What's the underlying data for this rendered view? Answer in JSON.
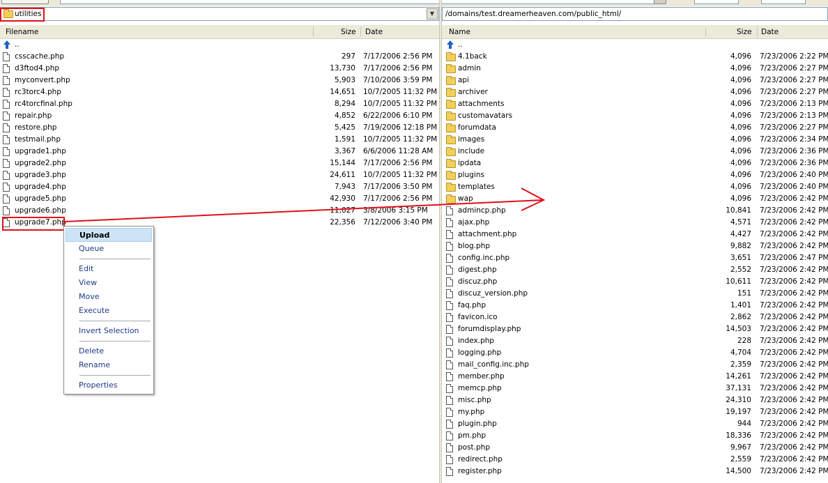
{
  "left": {
    "path": "utilities",
    "columns": {
      "name": "Filename",
      "size": "Size",
      "date": "Date"
    },
    "parent": "..",
    "files": [
      {
        "name": "csscache.php",
        "size": "297",
        "date": "7/17/2006 2:56 PM"
      },
      {
        "name": "d3ftod4.php",
        "size": "13,730",
        "date": "7/17/2006 2:56 PM"
      },
      {
        "name": "myconvert.php",
        "size": "5,903",
        "date": "7/10/2006 3:59 PM"
      },
      {
        "name": "rc3torc4.php",
        "size": "14,651",
        "date": "10/7/2005 11:32 PM"
      },
      {
        "name": "rc4torcfinal.php",
        "size": "8,294",
        "date": "10/7/2005 11:32 PM"
      },
      {
        "name": "repair.php",
        "size": "4,852",
        "date": "6/22/2006 6:10 PM"
      },
      {
        "name": "restore.php",
        "size": "5,425",
        "date": "7/19/2006 12:18 PM"
      },
      {
        "name": "testmail.php",
        "size": "1,591",
        "date": "10/7/2005 11:32 PM"
      },
      {
        "name": "upgrade1.php",
        "size": "3,367",
        "date": "6/6/2006 11:28 AM"
      },
      {
        "name": "upgrade2.php",
        "size": "15,144",
        "date": "7/17/2006 2:56 PM"
      },
      {
        "name": "upgrade3.php",
        "size": "24,611",
        "date": "10/7/2005 11:32 PM"
      },
      {
        "name": "upgrade4.php",
        "size": "7,943",
        "date": "7/17/2006 3:50 PM"
      },
      {
        "name": "upgrade5.php",
        "size": "42,930",
        "date": "7/17/2006 2:56 PM"
      },
      {
        "name": "upgrade6.php",
        "size": "11,027",
        "date": "3/8/2006 3:15 PM"
      },
      {
        "name": "upgrade7.php",
        "size": "22,356",
        "date": "7/12/2006 3:40 PM"
      }
    ]
  },
  "right": {
    "path": "/domains/test.dreamerheaven.com/public_html/",
    "columns": {
      "name": "Name",
      "size": "Size",
      "date": "Date"
    },
    "parent": "..",
    "items": [
      {
        "type": "folder",
        "name": "4.1back",
        "size": "4,096",
        "date": "7/23/2006 2:22 PM"
      },
      {
        "type": "folder",
        "name": "admin",
        "size": "4,096",
        "date": "7/23/2006 2:27 PM"
      },
      {
        "type": "folder",
        "name": "api",
        "size": "4,096",
        "date": "7/23/2006 2:27 PM"
      },
      {
        "type": "folder",
        "name": "archiver",
        "size": "4,096",
        "date": "7/23/2006 2:27 PM"
      },
      {
        "type": "folder",
        "name": "attachments",
        "size": "4,096",
        "date": "7/23/2006 2:13 PM"
      },
      {
        "type": "folder",
        "name": "customavatars",
        "size": "4,096",
        "date": "7/23/2006 2:13 PM"
      },
      {
        "type": "folder",
        "name": "forumdata",
        "size": "4,096",
        "date": "7/23/2006 2:27 PM"
      },
      {
        "type": "folder",
        "name": "images",
        "size": "4,096",
        "date": "7/23/2006 2:34 PM"
      },
      {
        "type": "folder",
        "name": "include",
        "size": "4,096",
        "date": "7/23/2006 2:36 PM"
      },
      {
        "type": "folder",
        "name": "ipdata",
        "size": "4,096",
        "date": "7/23/2006 2:36 PM"
      },
      {
        "type": "folder",
        "name": "plugins",
        "size": "4,096",
        "date": "7/23/2006 2:40 PM"
      },
      {
        "type": "folder",
        "name": "templates",
        "size": "4,096",
        "date": "7/23/2006 2:40 PM"
      },
      {
        "type": "folder",
        "name": "wap",
        "size": "4,096",
        "date": "7/23/2006 2:42 PM"
      },
      {
        "type": "file",
        "name": "admincp.php",
        "size": "10,841",
        "date": "7/23/2006 2:42 PM"
      },
      {
        "type": "file",
        "name": "ajax.php",
        "size": "4,571",
        "date": "7/23/2006 2:42 PM"
      },
      {
        "type": "file",
        "name": "attachment.php",
        "size": "4,427",
        "date": "7/23/2006 2:42 PM"
      },
      {
        "type": "file",
        "name": "blog.php",
        "size": "9,882",
        "date": "7/23/2006 2:42 PM"
      },
      {
        "type": "file",
        "name": "config.inc.php",
        "size": "3,651",
        "date": "7/23/2006 2:47 PM"
      },
      {
        "type": "file",
        "name": "digest.php",
        "size": "2,552",
        "date": "7/23/2006 2:42 PM"
      },
      {
        "type": "file",
        "name": "discuz.php",
        "size": "10,611",
        "date": "7/23/2006 2:42 PM"
      },
      {
        "type": "file",
        "name": "discuz_version.php",
        "size": "151",
        "date": "7/23/2006 2:42 PM"
      },
      {
        "type": "file",
        "name": "faq.php",
        "size": "1,401",
        "date": "7/23/2006 2:42 PM"
      },
      {
        "type": "file",
        "name": "favicon.ico",
        "size": "2,862",
        "date": "7/23/2006 2:42 PM"
      },
      {
        "type": "file",
        "name": "forumdisplay.php",
        "size": "14,503",
        "date": "7/23/2006 2:42 PM"
      },
      {
        "type": "file",
        "name": "index.php",
        "size": "228",
        "date": "7/23/2006 2:42 PM"
      },
      {
        "type": "file",
        "name": "logging.php",
        "size": "4,704",
        "date": "7/23/2006 2:42 PM"
      },
      {
        "type": "file",
        "name": "mail_config.inc.php",
        "size": "2,359",
        "date": "7/23/2006 2:42 PM"
      },
      {
        "type": "file",
        "name": "member.php",
        "size": "14,261",
        "date": "7/23/2006 2:42 PM"
      },
      {
        "type": "file",
        "name": "memcp.php",
        "size": "37,131",
        "date": "7/23/2006 2:42 PM"
      },
      {
        "type": "file",
        "name": "misc.php",
        "size": "24,310",
        "date": "7/23/2006 2:42 PM"
      },
      {
        "type": "file",
        "name": "my.php",
        "size": "19,197",
        "date": "7/23/2006 2:42 PM"
      },
      {
        "type": "file",
        "name": "plugin.php",
        "size": "944",
        "date": "7/23/2006 2:42 PM"
      },
      {
        "type": "file",
        "name": "pm.php",
        "size": "18,336",
        "date": "7/23/2006 2:42 PM"
      },
      {
        "type": "file",
        "name": "post.php",
        "size": "9,967",
        "date": "7/23/2006 2:42 PM"
      },
      {
        "type": "file",
        "name": "redirect.php",
        "size": "2,559",
        "date": "7/23/2006 2:42 PM"
      },
      {
        "type": "file",
        "name": "register.php",
        "size": "14,500",
        "date": "7/23/2006 2:42 PM"
      }
    ]
  },
  "context_menu": {
    "items": [
      {
        "label": "Upload",
        "bold": true
      },
      {
        "label": "Queue"
      },
      {
        "sep": true
      },
      {
        "label": "Edit"
      },
      {
        "label": "View"
      },
      {
        "label": "Move"
      },
      {
        "label": "Execute"
      },
      {
        "sep": true
      },
      {
        "label": "Invert Selection"
      },
      {
        "sep": true
      },
      {
        "label": "Delete"
      },
      {
        "label": "Rename"
      },
      {
        "sep": true
      },
      {
        "label": "Properties"
      }
    ]
  },
  "colors": {
    "highlight_box": "#e0101a",
    "annotation_arrow": "#e0101a",
    "menu_hover": "#cde4f7"
  }
}
